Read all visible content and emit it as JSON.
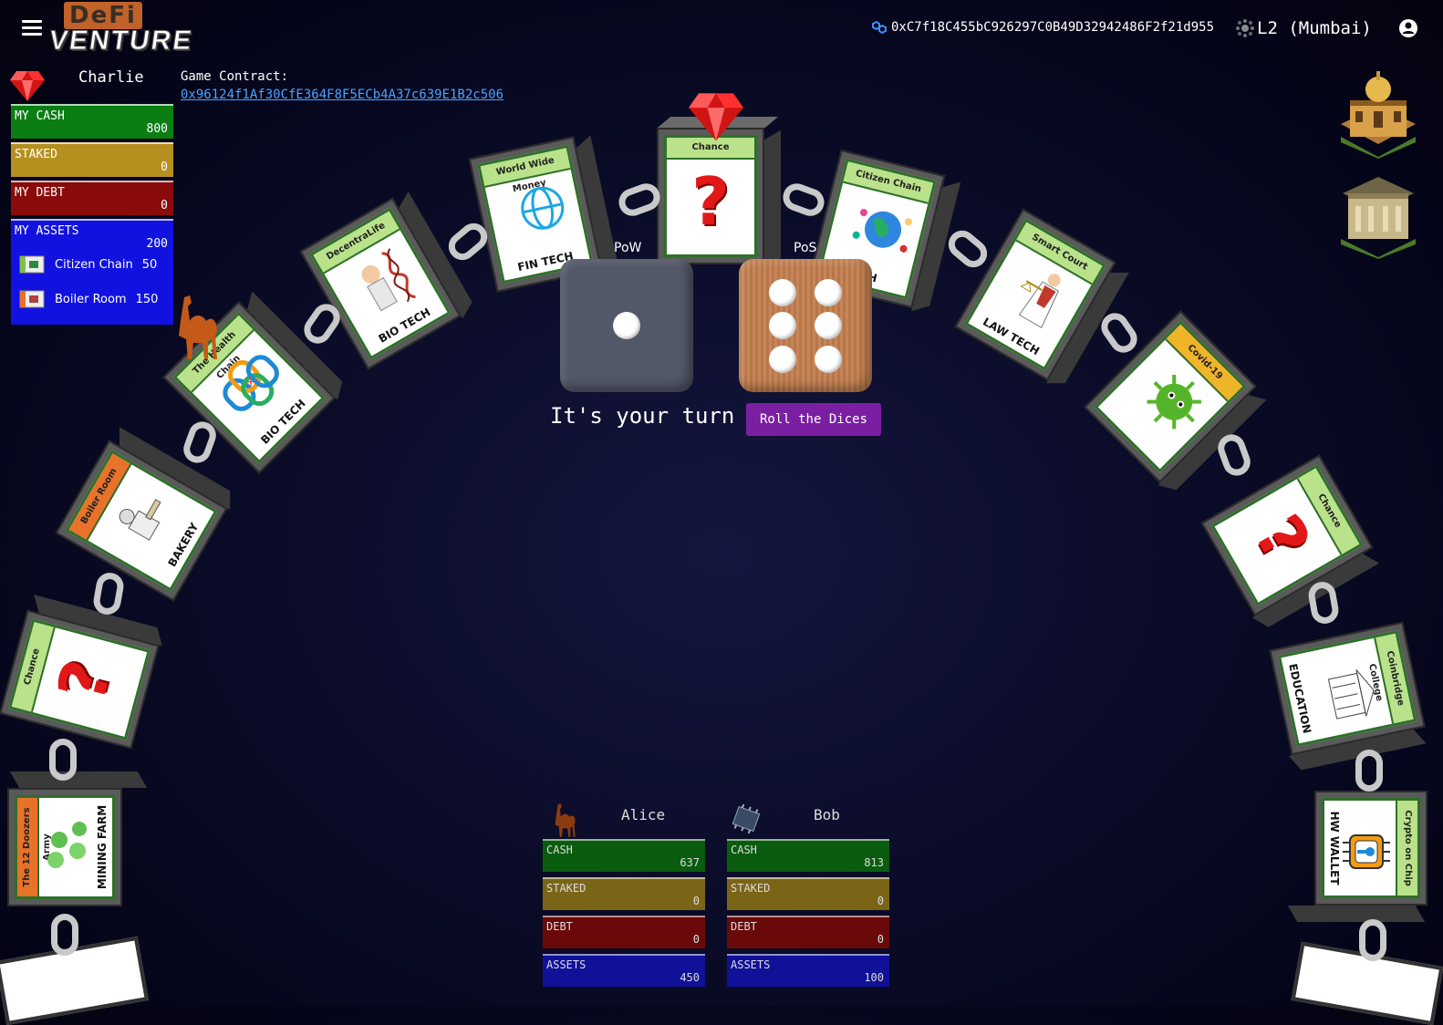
{
  "header": {
    "logo_top": "DeFi",
    "logo_bottom": "VENTURE",
    "wallet_address": "0xC7f18C455bC926297C0B49D32942486F2f21d955",
    "network": "L2 (Mumbai)"
  },
  "player": {
    "name": "Charlie",
    "token_icon": "ruby-gem-icon",
    "contract_label": "Game Contract:",
    "contract_address": "0x96124f1Af30CfE364F8F5ECb4A37c639E1B2c506",
    "cash_label": "MY CASH",
    "cash": "800",
    "staked_label": "STAKED",
    "staked": "0",
    "debt_label": "MY DEBT",
    "debt": "0",
    "assets_label": "MY ASSETS",
    "assets": "200",
    "asset_items": [
      {
        "name": "Citizen Chain",
        "value": "50"
      },
      {
        "name": "Boiler Room",
        "value": "150"
      }
    ]
  },
  "board": {
    "tiles": [
      {
        "title": "Chance",
        "category": ""
      },
      {
        "title": "World Wide Money",
        "category": "FIN TECH"
      },
      {
        "title": "DecentraLife",
        "category": "BIO TECH"
      },
      {
        "title": "The Health Chain",
        "category": "BIO TECH"
      },
      {
        "title": "Boiler Room",
        "category": "BAKERY"
      },
      {
        "title": "Chance",
        "category": ""
      },
      {
        "title": "The 12 Doozers Army",
        "category": "MINING FARM"
      },
      {
        "title": "Citizen Chain",
        "category": "ECH"
      },
      {
        "title": "Smart Court",
        "category": "LAW TECH"
      },
      {
        "title": "Covid-19",
        "category": ""
      },
      {
        "title": "Chance",
        "category": ""
      },
      {
        "title": "Coinbridge College",
        "category": "EDUCATION"
      },
      {
        "title": "Crypto on Chip",
        "category": "HW WALLET"
      }
    ]
  },
  "dice": {
    "pow_label": "PoW",
    "pos_label": "PoS",
    "pow_value": 1,
    "pos_value": 6,
    "turn_text": "It's your turn",
    "roll_button": "Roll the Dices"
  },
  "opponents": [
    {
      "name": "Alice",
      "token_icon": "camel-icon",
      "cash_label": "CASH",
      "cash": "637",
      "staked_label": "STAKED",
      "staked": "0",
      "debt_label": "DEBT",
      "debt": "0",
      "assets_label": "ASSETS",
      "assets": "450"
    },
    {
      "name": "Bob",
      "token_icon": "chip-icon",
      "cash_label": "CASH",
      "cash": "813",
      "staked_label": "STAKED",
      "staked": "0",
      "debt_label": "DEBT",
      "debt": "0",
      "assets_label": "ASSETS",
      "assets": "100"
    }
  ],
  "side_icons": [
    "palace-building-icon",
    "bank-building-icon"
  ]
}
